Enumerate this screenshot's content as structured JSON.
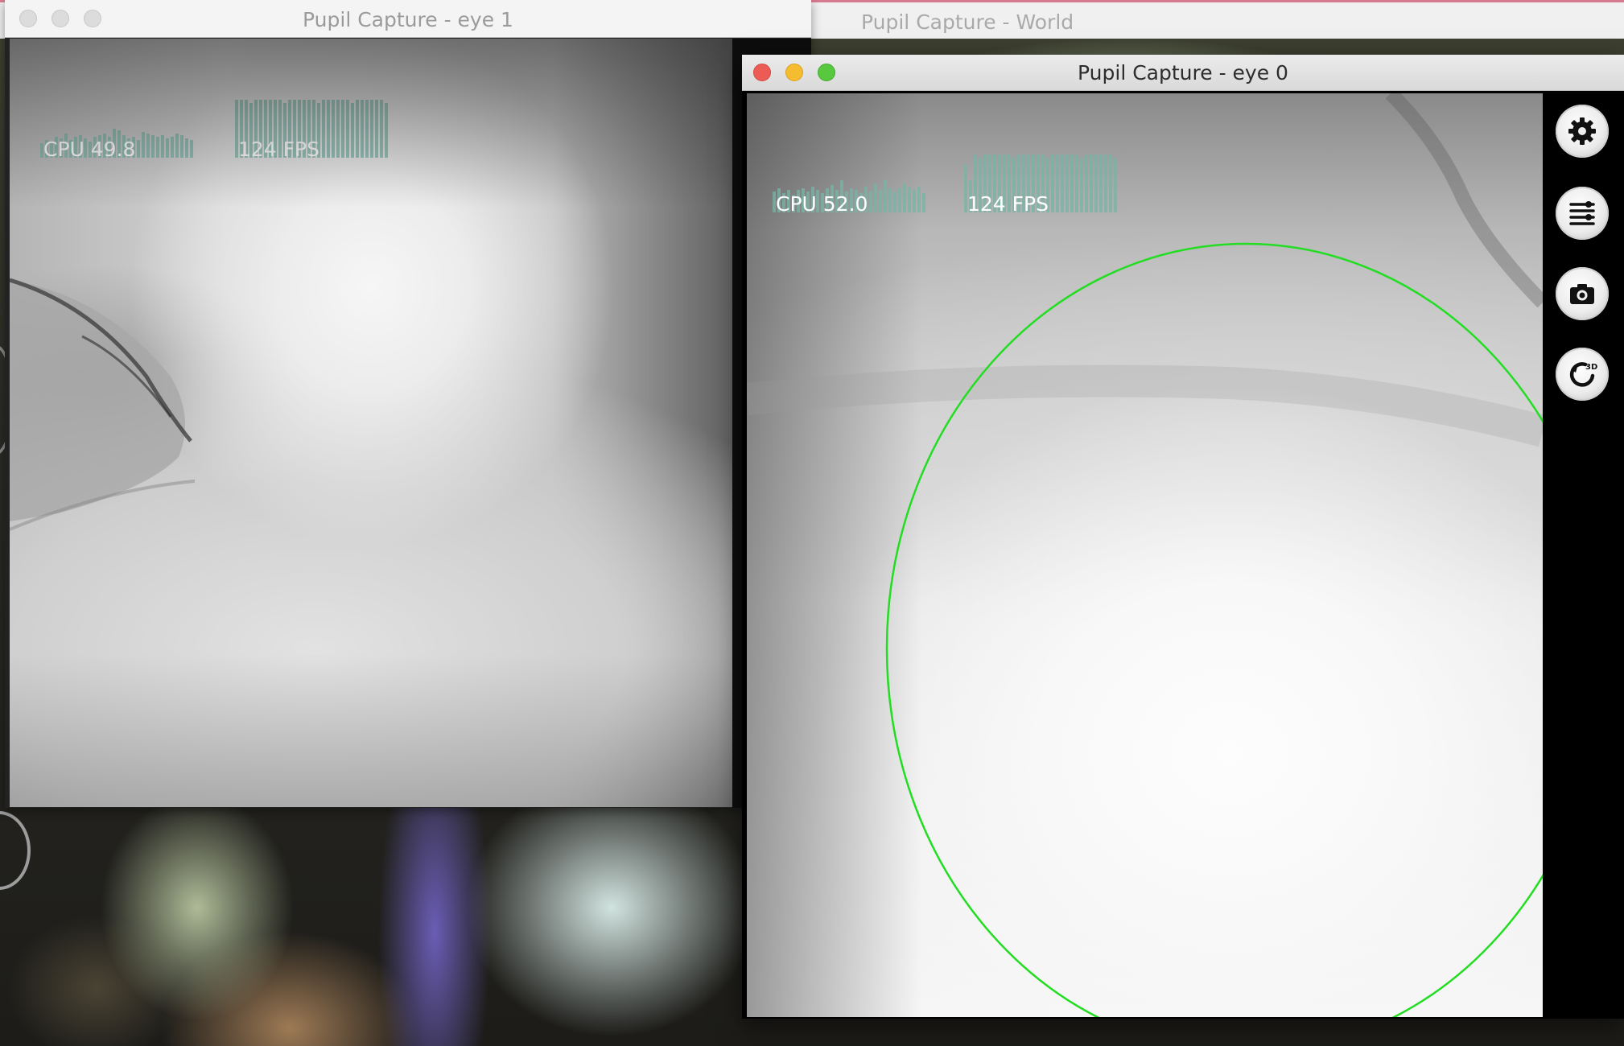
{
  "world": {
    "title": "Pupil Capture - World"
  },
  "eye1": {
    "title": "Pupil Capture - eye 1",
    "cpu_label": "CPU 49.8",
    "fps_label": "124 FPS",
    "cpu_value": 49.8,
    "fps_value": 124
  },
  "eye0": {
    "title": "Pupil Capture - eye 0",
    "cpu_label": "CPU 52.0",
    "fps_label": "124 FPS",
    "cpu_value": 52.0,
    "fps_value": 124,
    "pupil_ellipse_color": "#22dd22"
  },
  "sidebar": {
    "buttons": [
      {
        "name": "settings",
        "icon": "gear-icon"
      },
      {
        "name": "plugins",
        "icon": "sliders-icon"
      },
      {
        "name": "snapshot",
        "icon": "camera-icon"
      },
      {
        "name": "eye-model",
        "icon": "3d-refresh-icon",
        "badge": "3D"
      }
    ]
  },
  "colors": {
    "close": "#ed5b56",
    "minimize": "#f5bc2f",
    "zoom": "#58c83f",
    "graph": "#78b4a6"
  }
}
